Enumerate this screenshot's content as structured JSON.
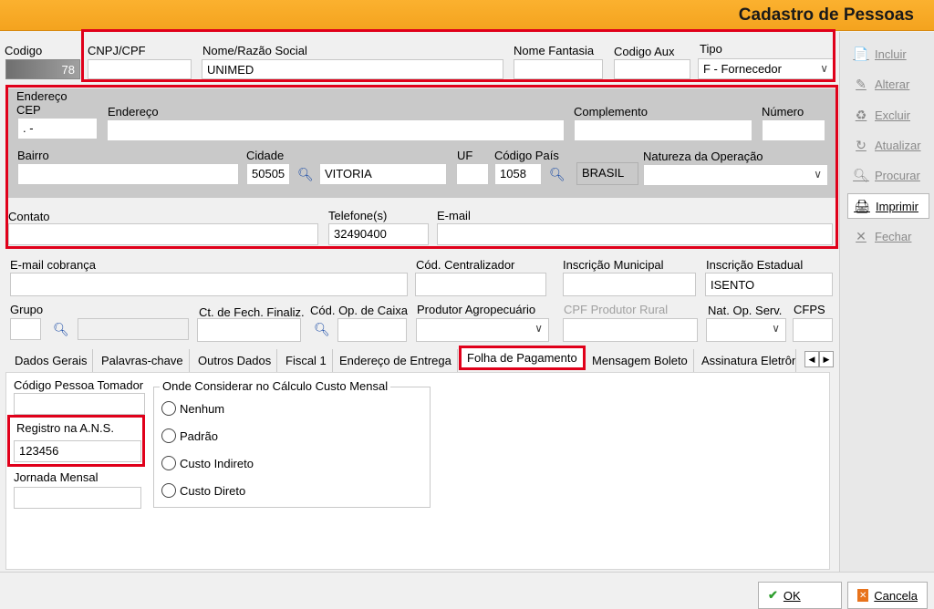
{
  "window": {
    "title": "Cadastro de Pessoas"
  },
  "header": {
    "codigo_label": "Codigo",
    "codigo_value": "78",
    "cnpj_label": "CNPJ/CPF",
    "cnpj_value": "",
    "nome_label": "Nome/Razão Social",
    "nome_value": "UNIMED",
    "fantasia_label": "Nome Fantasia",
    "fantasia_value": "",
    "aux_label": "Codigo Aux",
    "aux_value": "",
    "tipo_label": "Tipo",
    "tipo_value": "F - Fornecedor"
  },
  "endereco": {
    "section_label": "Endereço",
    "cep_label": "CEP",
    "cep_value": ". -",
    "endereco_label": "Endereço",
    "endereco_value": "",
    "complemento_label": "Complemento",
    "complemento_value": "",
    "numero_label": "Número",
    "numero_value": "",
    "bairro_label": "Bairro",
    "bairro_value": "",
    "cidade_label": "Cidade",
    "cidade_code": "50505",
    "cidade_name": "VITORIA",
    "uf_label": "UF",
    "uf_value": "",
    "pais_label": "Código País",
    "pais_code": "1058",
    "pais_name": "BRASIL",
    "natureza_label": "Natureza da Operação",
    "natureza_value": ""
  },
  "contato": {
    "contato_label": "Contato",
    "contato_value": "",
    "telefone_label": "Telefone(s)",
    "telefone_value": "32490400",
    "email_label": "E-mail",
    "email_value": ""
  },
  "extra": {
    "email_cobranca_label": "E-mail cobrança",
    "cod_centralizador_label": "Cód. Centralizador",
    "insc_municipal_label": "Inscrição Municipal",
    "insc_estadual_label": "Inscrição Estadual",
    "insc_estadual_value": "ISENTO",
    "grupo_label": "Grupo",
    "ct_fech_label": "Ct. de Fech. Finaliz.",
    "cod_op_caixa_label": "Cód. Op. de Caixa",
    "produtor_label": "Produtor Agropecuário",
    "cpf_produtor_label": "CPF Produtor Rural",
    "nat_op_serv_label": "Nat. Op. Serv.",
    "cfps_label": "CFPS"
  },
  "tabs": [
    {
      "label": "Dados Gerais"
    },
    {
      "label": "Palavras-chave"
    },
    {
      "label": "Outros Dados"
    },
    {
      "label": "Fiscal 1"
    },
    {
      "label": "Endereço de Entrega"
    },
    {
      "label": "Folha de Pagamento"
    },
    {
      "label": "Mensagem Boleto"
    },
    {
      "label": "Assinatura Eletrôn"
    }
  ],
  "folha": {
    "tomador_label": "Código Pessoa Tomador",
    "tomador_value": "",
    "ans_label": "Registro na A.N.S.",
    "ans_value": "123456",
    "jornada_label": "Jornada Mensal",
    "jornada_value": "",
    "group_label": "Onde Considerar no Cálculo Custo Mensal",
    "options": [
      "Nenhum",
      "Padrão",
      "Custo Indireto",
      "Custo Direto"
    ]
  },
  "sidebar": {
    "incluir": "Incluir",
    "alterar": "Alterar",
    "excluir": "Excluir",
    "atualizar": "Atualizar",
    "procurar": "Procurar",
    "imprimir": "Imprimir",
    "fechar": "Fechar"
  },
  "footer": {
    "ok": "OK",
    "cancela": "Cancela"
  },
  "colors": {
    "titlebar": "#f4a31e",
    "highlight": "#e0001a"
  }
}
